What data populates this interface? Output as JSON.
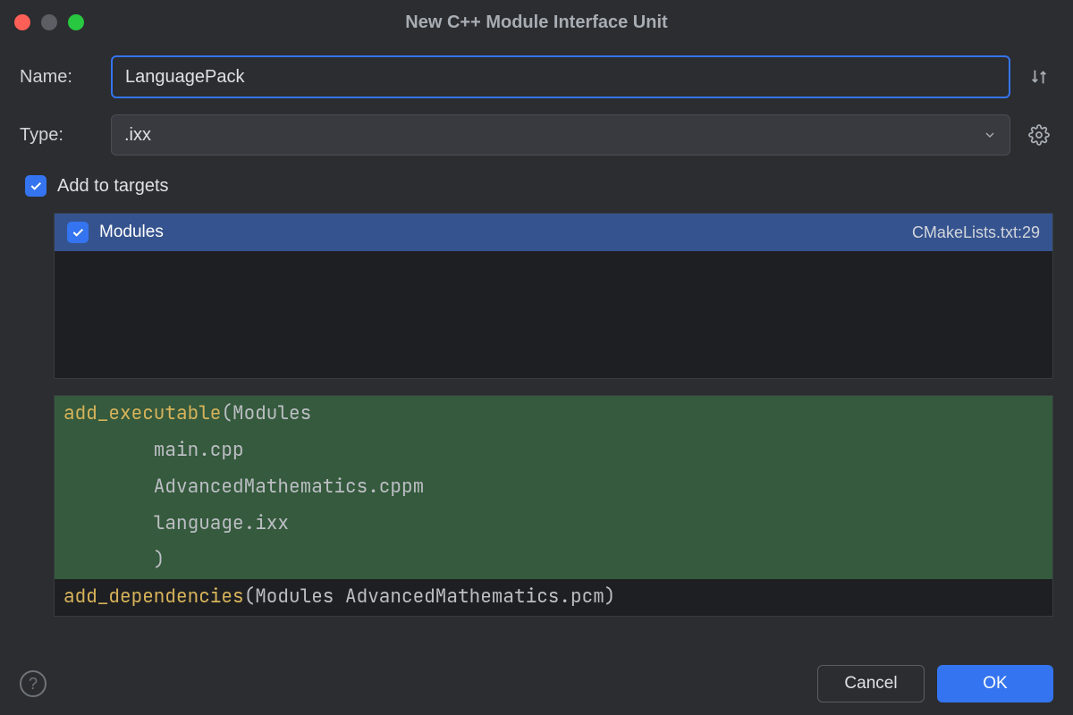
{
  "window": {
    "title": "New C++ Module Interface Unit"
  },
  "form": {
    "name_label": "Name:",
    "name_value": "LanguagePack",
    "type_label": "Type:",
    "type_value": ".ixx",
    "add_to_targets_label": "Add to targets"
  },
  "targets": [
    {
      "name": "Modules",
      "file": "CMakeLists.txt:29",
      "checked": true
    }
  ],
  "code": {
    "l1_kw": "add_executable",
    "l1_rest": "(Modules",
    "l2": "        main.cpp",
    "l3": "        AdvancedMathematics.cppm",
    "l4": "        language.ixx",
    "l5": "        )",
    "l6_kw": "add_dependencies",
    "l6_rest": "(Modules AdvancedMathematics.pcm)"
  },
  "buttons": {
    "cancel": "Cancel",
    "ok": "OK"
  }
}
